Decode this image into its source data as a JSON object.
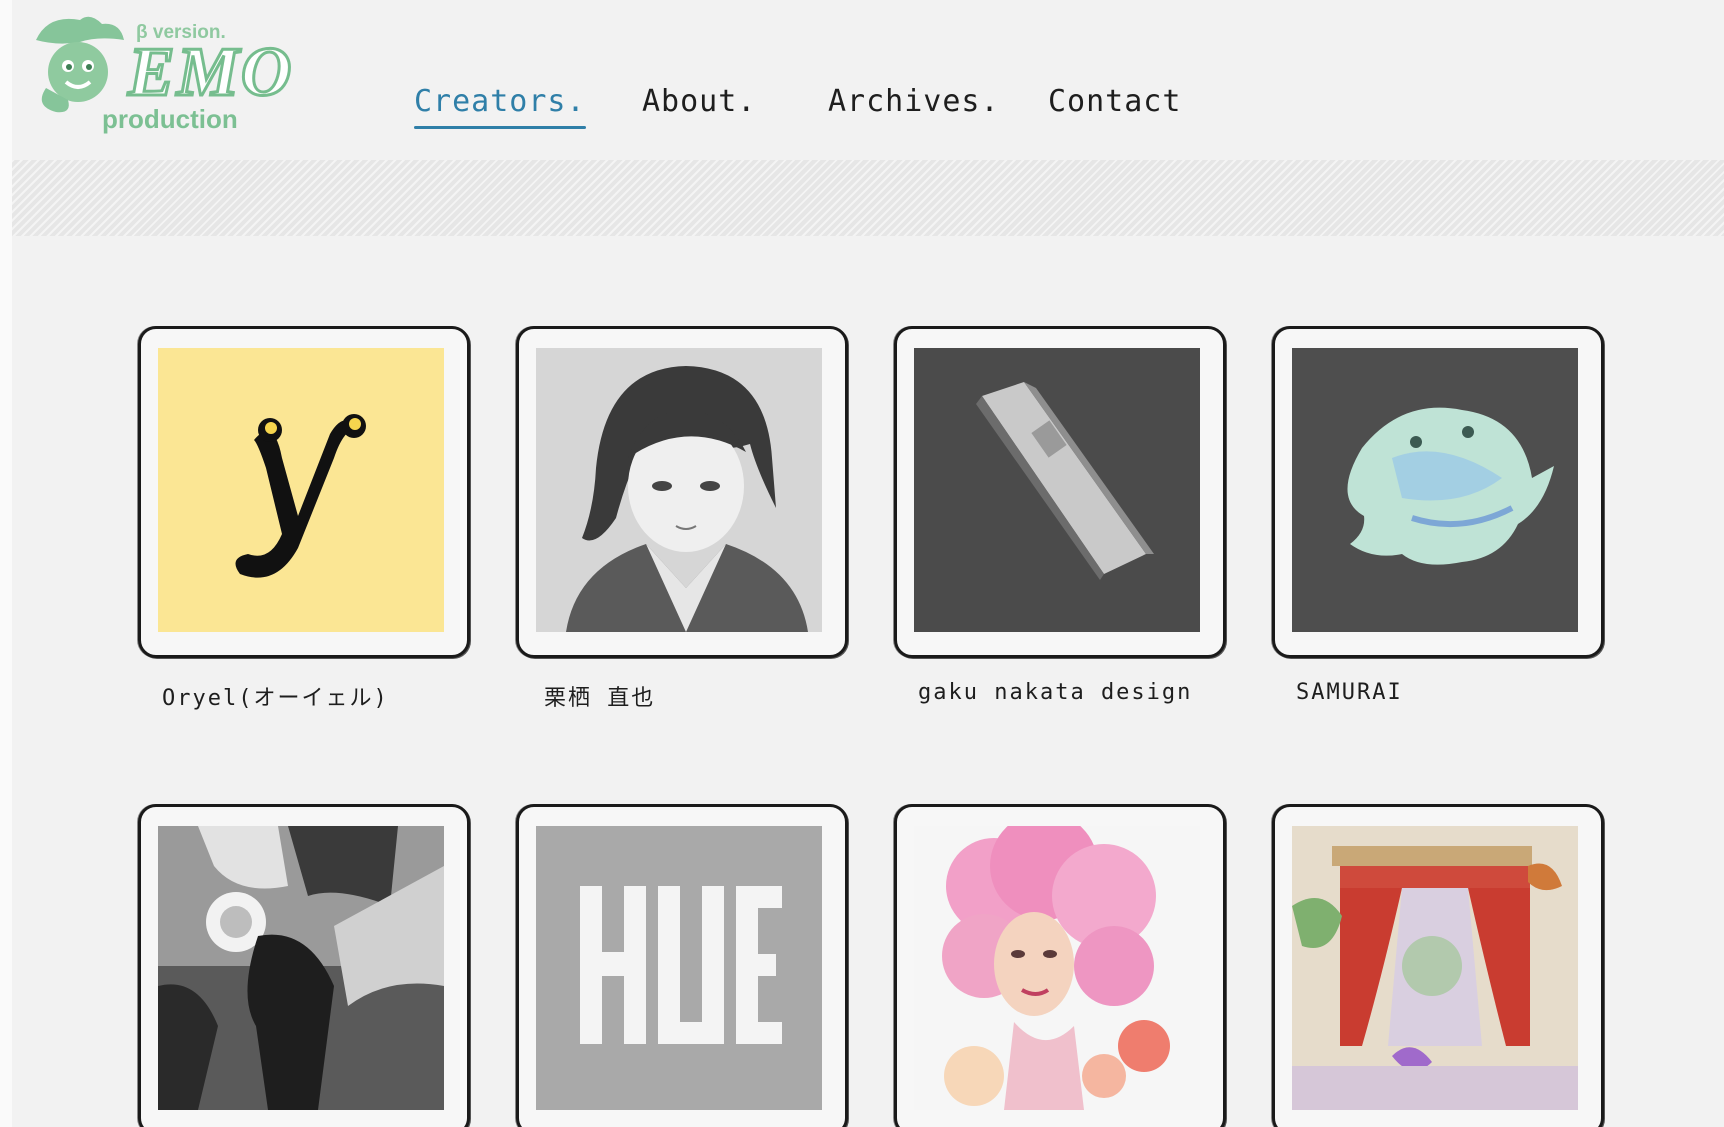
{
  "logo": {
    "beta": "β version.",
    "word": "EMO",
    "production": "production"
  },
  "nav": {
    "items": [
      {
        "label": "Creators.",
        "active": true
      },
      {
        "label": "About."
      },
      {
        "label": "Archives."
      },
      {
        "label": "Contact"
      }
    ]
  },
  "colors": {
    "accent": "#2f7fa8",
    "brand_green": "#76bd8e",
    "background": "#f2f2f2"
  },
  "creators": [
    {
      "name": "Oryel(オーイェル)",
      "thumb": "yellow-y-logo"
    },
    {
      "name": "栗栖 直也",
      "thumb": "manga-girl-illustration"
    },
    {
      "name": "gaku nakata design",
      "thumb": "product-box-photo"
    },
    {
      "name": "SAMURAI",
      "thumb": "glass-fish-sculpture"
    },
    {
      "name": "",
      "thumb": "robot-helmet-art"
    },
    {
      "name": "",
      "thumb": "hue-logo",
      "text": "HUE"
    },
    {
      "name": "",
      "thumb": "pink-hair-portrait"
    },
    {
      "name": "",
      "thumb": "red-curtain-collage"
    }
  ]
}
